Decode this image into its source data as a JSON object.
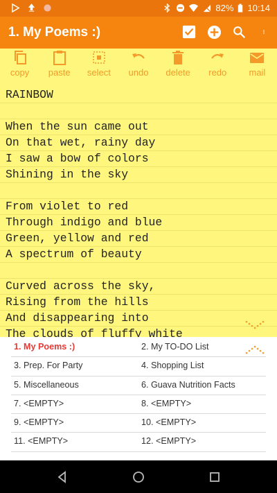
{
  "status": {
    "battery": "82%",
    "time": "10:14",
    "icons": [
      "play-store-icon",
      "upload-icon",
      "record-dot-icon",
      "bluetooth-icon",
      "do-not-disturb-icon",
      "wifi-icon",
      "no-sim-icon",
      "battery-icon"
    ]
  },
  "app": {
    "title": "1. My Poems :)",
    "actions": [
      "check-icon",
      "add-icon",
      "search-icon",
      "more-icon"
    ],
    "accent": "#f5850e",
    "note_bg": "#fff77d"
  },
  "toolbar": {
    "copy": "copy",
    "paste": "paste",
    "select": "select",
    "undo": "undo",
    "delete": "delete",
    "redo": "redo",
    "mail": "mail"
  },
  "note": {
    "text": "RAINBOW\n\nWhen the sun came out\nOn that wet, rainy day\nI saw a bow of colors\nShining in the sky\n\nFrom violet to red\nThrough indigo and blue\nGreen, yellow and red\nA spectrum of beauty\n\nCurved across the sky,\nRising from the hills\nAnd disappearing into\nThe clouds of fluffy white"
  },
  "notes_list": [
    {
      "label": "1. My Poems :)",
      "active": true
    },
    {
      "label": "2. My TO-DO List",
      "active": false
    },
    {
      "label": "3. Prep. For Party",
      "active": false
    },
    {
      "label": "4. Shopping List",
      "active": false
    },
    {
      "label": "5. Miscellaneous",
      "active": false
    },
    {
      "label": "6. Guava Nutrition Facts",
      "active": false
    },
    {
      "label": "7. <EMPTY>",
      "active": false
    },
    {
      "label": "8. <EMPTY>",
      "active": false
    },
    {
      "label": "9. <EMPTY>",
      "active": false
    },
    {
      "label": "10. <EMPTY>",
      "active": false
    },
    {
      "label": "11. <EMPTY>",
      "active": false
    },
    {
      "label": "12. <EMPTY>",
      "active": false
    }
  ]
}
